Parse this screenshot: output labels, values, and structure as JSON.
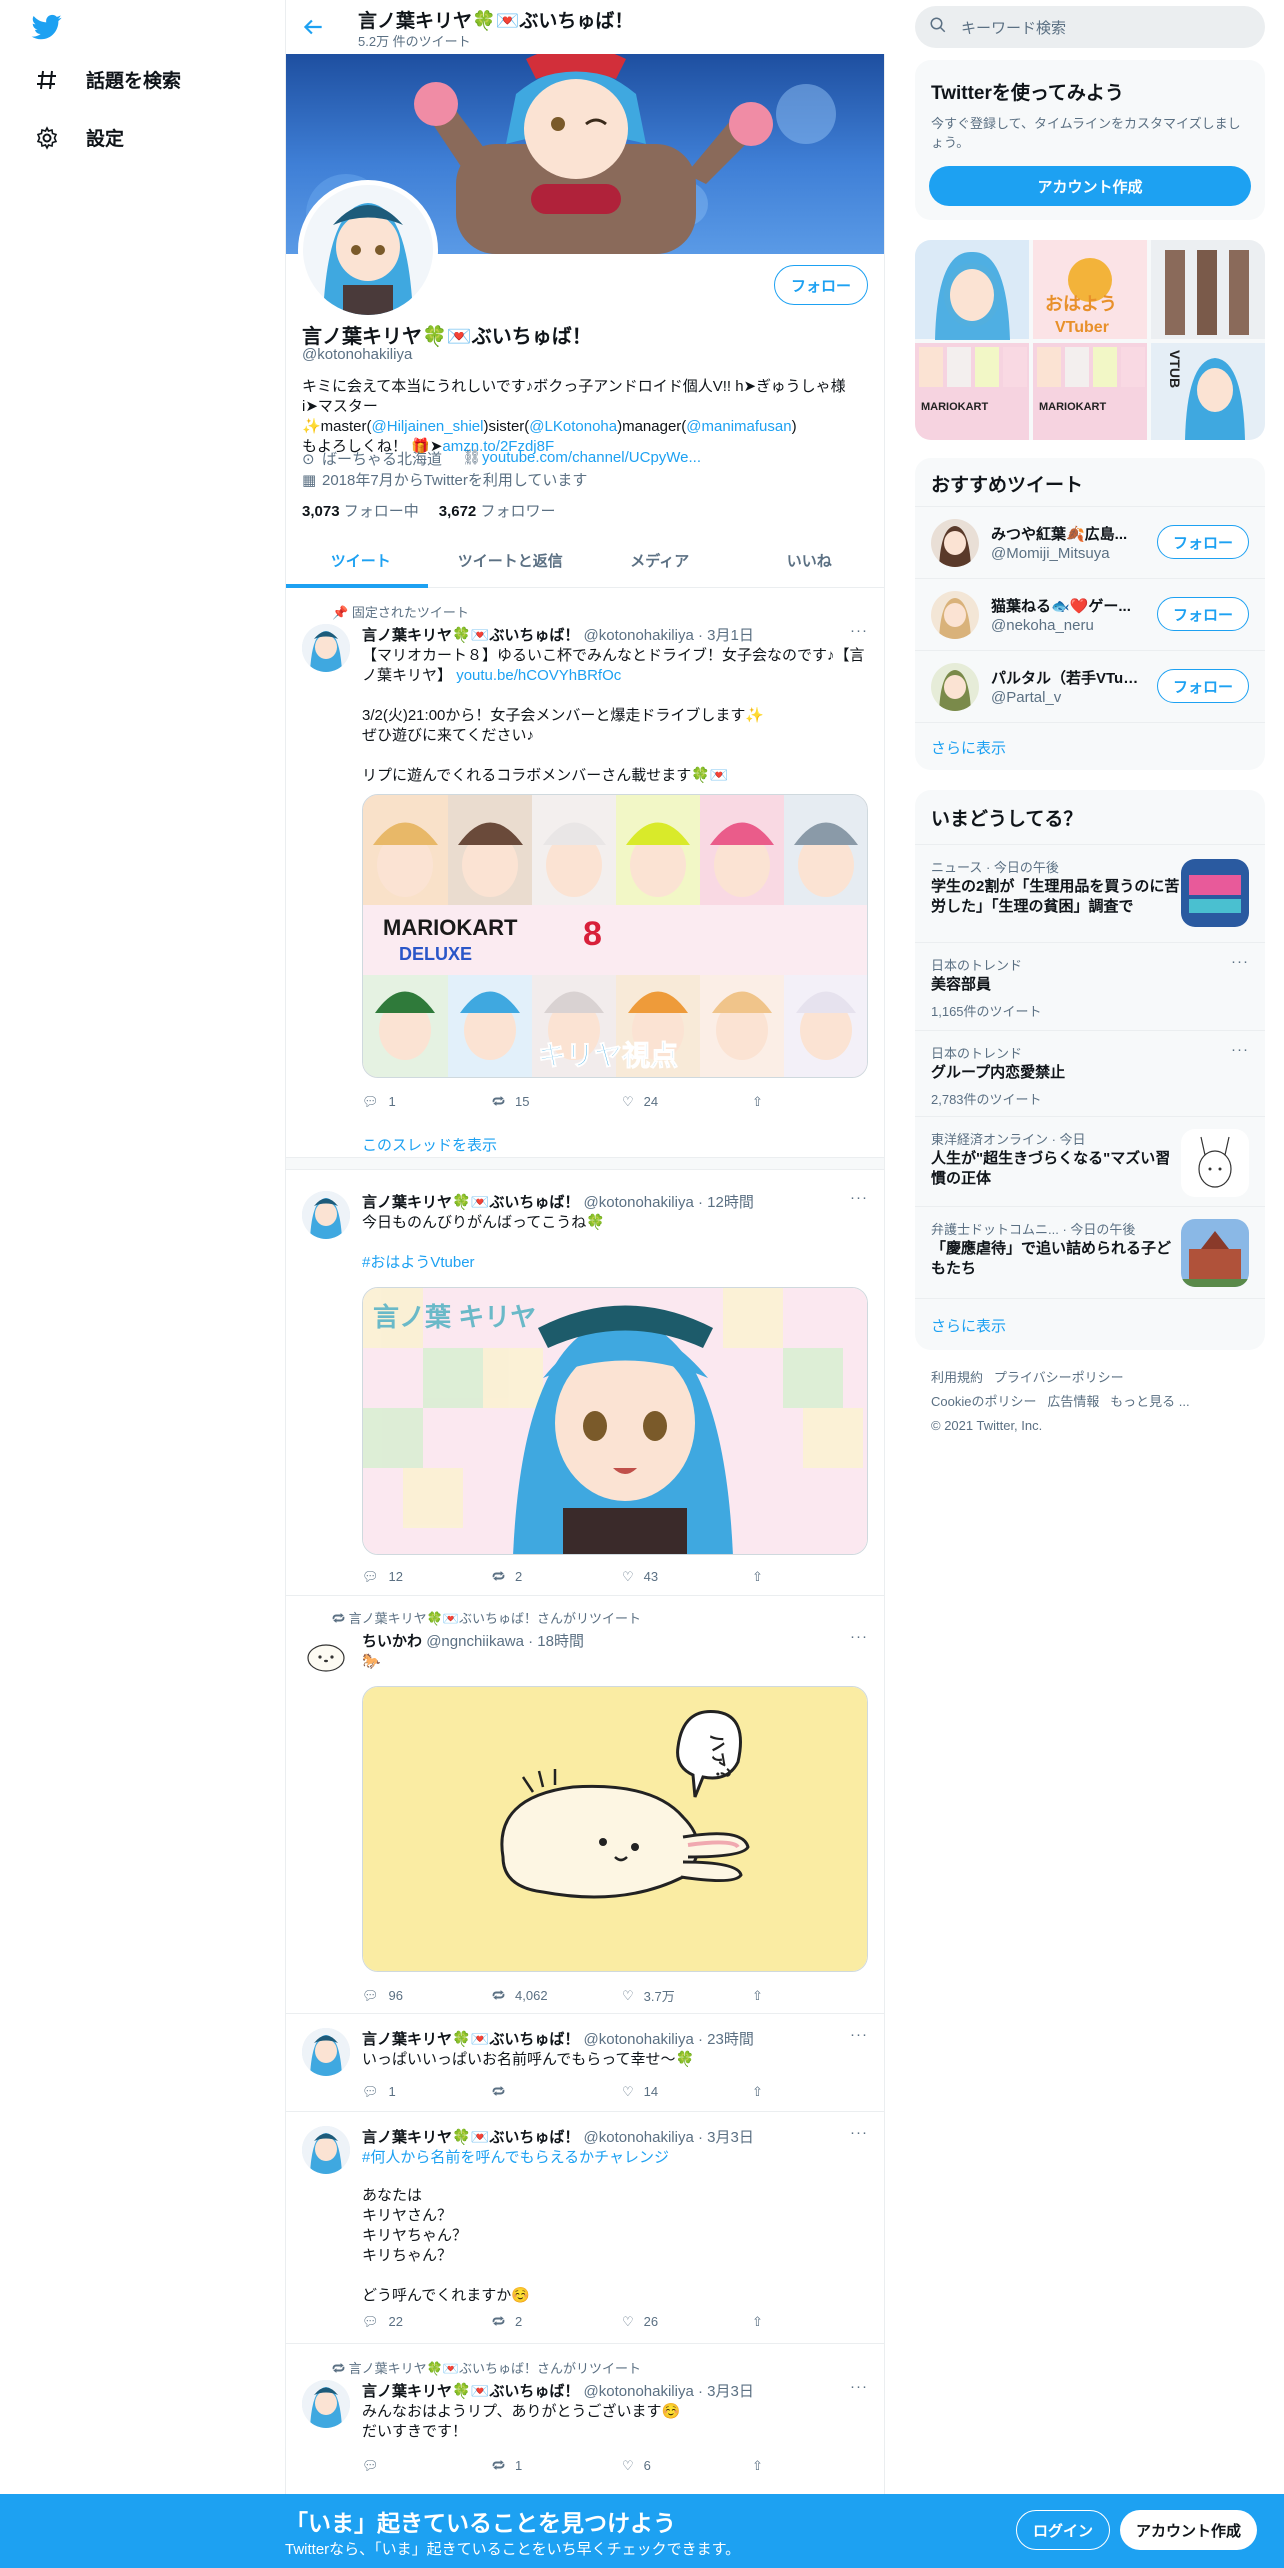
{
  "nav": {
    "explore": "話題を検索",
    "settings": "設定"
  },
  "header": {
    "title": "言ノ葉キリヤ🍀💌ぶいちゅば！",
    "tweet_count": "5.2万 件のツイート"
  },
  "profile": {
    "follow": "フォロー",
    "name": "言ノ葉キリヤ🍀💌ぶいちゅば！",
    "handle": "@kotonohakiliya",
    "bio_1": "キミに会えて本当にうれしいです♪ボクっ子アンドロイド個人V!! h➤ぎゅうしゃ様",
    "bio_2a": "i➤マスター✨master(",
    "bio_2b": "@Hiljainen_shiel",
    "bio_2c": ")sister(",
    "bio_2d": "@LKotonoha",
    "bio_2e": ")manager(",
    "bio_2f": "@manimafusan",
    "bio_2g": ")",
    "bio_3a": "もよろしくね！ 🎁➤",
    "bio_3b": "amzn.to/2Fzdj8F",
    "location": "ばーちゃる北海道",
    "url": "youtube.com/channel/UCpyWe...",
    "joined": "2018年7月からTwitterを利用しています",
    "following_count": "3,073",
    "following_label": "フォロー中",
    "followers_count": "3,672",
    "followers_label": "フォロワー"
  },
  "tabs": [
    "ツイート",
    "ツイートと返信",
    "メディア",
    "いいね"
  ],
  "tweets": [
    {
      "social": "固定されたツイート",
      "name": "言ノ葉キリヤ🍀💌ぶいちゅば！",
      "meta": "@kotonohakiliya · 3月1日",
      "text_1": "【マリオカート８】ゆるいこ杯でみんなとドライブ！女子会なのです♪【言",
      "text_2a": "ノ葉キリヤ】",
      "text_2b": "youtu.be/hCOVYhBRfOc",
      "text_3": "3/2(火)21:00から！女子会メンバーと爆走ドライブします✨\nぜひ遊びに来てください♪\n\nリプに遊んでくれるコラボメンバーさん載せます🍀💌",
      "img_caption": "キリヤ視点",
      "replies": "1",
      "retweets": "15",
      "likes": "24",
      "thread": "このスレッドを表示"
    },
    {
      "name": "言ノ葉キリヤ🍀💌ぶいちゅば！",
      "meta": "@kotonohakiliya · 12時間",
      "text": "今日ものんびりがんばってこうね🍀",
      "hashtag": "#おはようVtuber",
      "replies": "12",
      "retweets": "2",
      "likes": "43"
    },
    {
      "social": "言ノ葉キリヤ🍀💌ぶいちゅば！さんがリツイート",
      "name": "ちいかわ",
      "meta": "@ngnchiikawa · 18時間",
      "text": "🐎",
      "replies": "96",
      "retweets": "4,062",
      "likes": "3.7万"
    },
    {
      "name": "言ノ葉キリヤ🍀💌ぶいちゅば！",
      "meta": "@kotonohakiliya · 23時間",
      "text": "いっぱいいっぱいお名前呼んでもらって幸せ～🍀",
      "replies": "1",
      "retweets": "",
      "likes": "14"
    },
    {
      "name": "言ノ葉キリヤ🍀💌ぶいちゅば！",
      "meta": "@kotonohakiliya · 3月3日",
      "hashtag": "#何人から名前を呼んでもらえるかチャレンジ",
      "text": "あなたは\nキリヤさん？\nキリヤちゃん？\nキリちゃん？\n\nどう呼んでくれますか☺️",
      "replies": "22",
      "retweets": "2",
      "likes": "26"
    },
    {
      "social": "言ノ葉キリヤ🍀💌ぶいちゅば！さんがリツイート",
      "name": "言ノ葉キリヤ🍀💌ぶいちゅば！",
      "meta": "@kotonohakiliya · 3月3日",
      "text": "みんなおはようリプ、ありがとうございます☺️\nだいすきです！",
      "replies": "",
      "retweets": "1",
      "likes": "6"
    }
  ],
  "search": {
    "placeholder": "キーワード検索"
  },
  "signup_card": {
    "title": "Twitterを使ってみよう",
    "desc": "今すぐ登録して、タイムラインをカスタマイズしましょう。",
    "button": "アカウント作成"
  },
  "suggest": {
    "title": "おすすめツイート",
    "follow": "フォロー",
    "more": "さらに表示",
    "users": [
      {
        "name": "みつや紅葉🍂広島...",
        "handle": "@Momiji_Mitsuya"
      },
      {
        "name": "猫葉ねる🐟❤️ゲー...",
        "handle": "@nekoha_neru"
      },
      {
        "name": "パルタル（若手VTub...",
        "handle": "@Partal_v"
      }
    ]
  },
  "trends": {
    "title": "いまどうしてる？",
    "more": "さらに表示",
    "items": [
      {
        "ctx": "ニュース · 今日の午後",
        "title": "学生の2割が「生理用品を買うのに苦労した」「生理の貧困」調査で"
      },
      {
        "ctx": "日本のトレンド",
        "title": "美容部員",
        "count": "1,165件のツイート"
      },
      {
        "ctx": "日本のトレンド",
        "title": "グループ内恋愛禁止",
        "count": "2,783件のツイート"
      },
      {
        "ctx": "東洋経済オンライン · 今日",
        "title": "人生が\"超生きづらくなる\"マズい習慣の正体"
      },
      {
        "ctx": "弁護士ドットコムニ... · 今日の午後",
        "title": "「慶應虐待」で追い詰められる子どもたち"
      }
    ]
  },
  "footer": {
    "terms": "利用規約",
    "privacy": "プライバシーポリシー",
    "cookie": "Cookieのポリシー",
    "ads": "広告情報",
    "more": "もっと見る ...",
    "copyright": "© 2021 Twitter, Inc."
  },
  "bottom": {
    "title": "「いま」起きていることを見つけよう",
    "sub": "Twitterなら、「いま」起きていることをいち早くチェックできます。",
    "login": "ログイン",
    "signup": "アカウント作成"
  }
}
